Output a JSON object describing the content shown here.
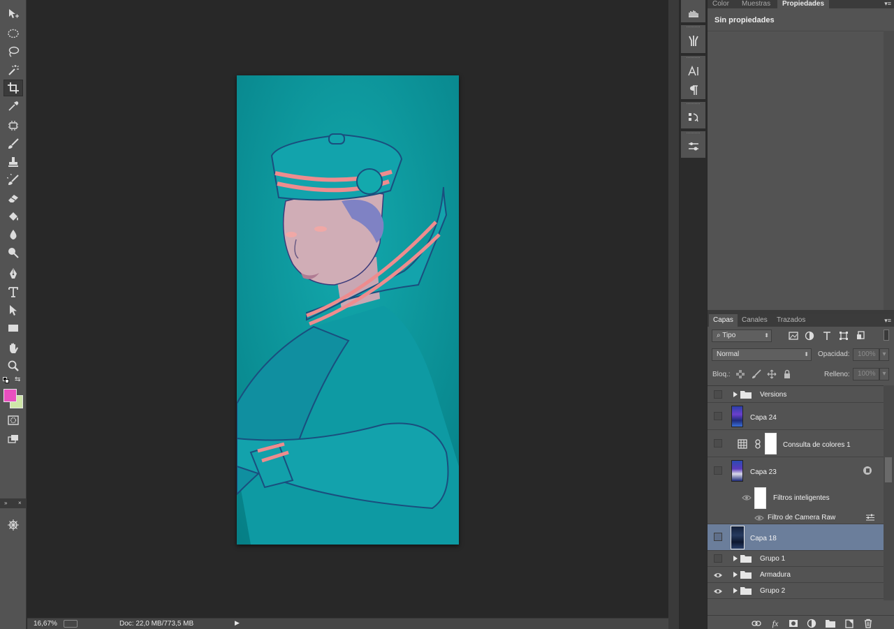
{
  "status_bar": {
    "zoom": "16,67%",
    "doc_size": "Doc: 22,0 MB/773,5 MB"
  },
  "tools": [
    {
      "name": "move-tool-icon"
    },
    {
      "name": "elliptical-marquee-tool-icon"
    },
    {
      "name": "lasso-tool-icon"
    },
    {
      "name": "magic-wand-tool-icon"
    },
    {
      "name": "crop-tool-icon"
    },
    {
      "name": "eyedropper-tool-icon"
    },
    {
      "name": "healing-brush-tool-icon"
    },
    {
      "name": "brush-tool-icon"
    },
    {
      "name": "clone-stamp-tool-icon"
    },
    {
      "name": "history-brush-tool-icon"
    },
    {
      "name": "eraser-tool-icon"
    },
    {
      "name": "paint-bucket-tool-icon"
    },
    {
      "name": "blur-tool-icon"
    },
    {
      "name": "dodge-tool-icon"
    },
    {
      "name": "pen-tool-icon"
    },
    {
      "name": "type-tool-icon"
    },
    {
      "name": "path-selection-tool-icon"
    },
    {
      "name": "rectangle-tool-icon"
    },
    {
      "name": "hand-tool-icon"
    },
    {
      "name": "zoom-tool-icon"
    }
  ],
  "colors": {
    "foreground": "#e84fbf",
    "background": "#cfe6a8",
    "canvas_bg": "#0a9aa0",
    "selected_layer": "#6b7e9b"
  },
  "top_panel": {
    "tabs": [
      "Color",
      "Muestras",
      "Propiedades"
    ],
    "active_tab": "Propiedades",
    "content_title": "Sin propiedades"
  },
  "layers_panel": {
    "tabs": [
      "Capas",
      "Canales",
      "Trazados"
    ],
    "active_tab": "Capas",
    "filter_kind": "Tipo",
    "blend_mode": "Normal",
    "opacity_label": "Opacidad:",
    "opacity_value": "100%",
    "lock_label": "Bloq.:",
    "fill_label": "Relleno:",
    "fill_value": "100%",
    "layers": [
      {
        "name": "Versions",
        "type": "group",
        "visible": false
      },
      {
        "name": "Capa 24",
        "type": "layer",
        "visible": false
      },
      {
        "name": "Consulta de colores 1",
        "type": "adjustment",
        "visible": false
      },
      {
        "name": "Capa 23",
        "type": "smart-object",
        "visible": false
      },
      {
        "name": "Filtros inteligentes",
        "type": "smart-filter-header",
        "visible": true
      },
      {
        "name": "Filtro de Camera Raw",
        "type": "smart-filter",
        "visible": true
      },
      {
        "name": "Capa 18",
        "type": "layer",
        "visible": false,
        "selected": true
      },
      {
        "name": "Grupo 1",
        "type": "group",
        "visible": false
      },
      {
        "name": "Armadura",
        "type": "group",
        "visible": true
      },
      {
        "name": "Grupo 2",
        "type": "group",
        "visible": true
      }
    ]
  }
}
